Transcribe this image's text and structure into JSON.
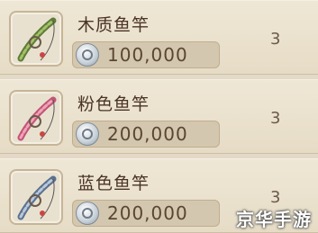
{
  "items": [
    {
      "name": "木质鱼竿",
      "price": "100,000",
      "count": "3",
      "rod_icon": "wooden-fishing-rod-icon",
      "color": "#6f8f45"
    },
    {
      "name": "粉色鱼竿",
      "price": "200,000",
      "count": "3",
      "rod_icon": "pink-fishing-rod-icon",
      "color": "#d86a86"
    },
    {
      "name": "蓝色鱼竿",
      "price": "200,000",
      "count": "3",
      "rod_icon": "blue-fishing-rod-icon",
      "color": "#6f88a8"
    }
  ],
  "currency_icon": "silver-coin-icon",
  "watermark": "京华手游"
}
